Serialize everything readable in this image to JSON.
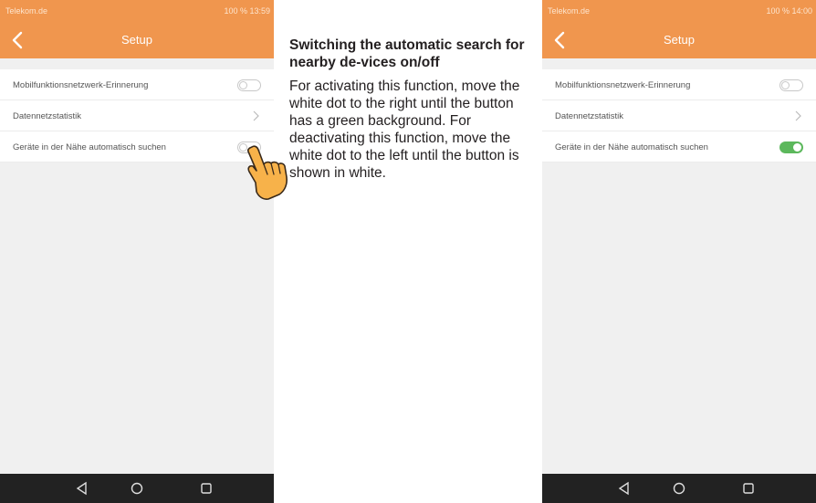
{
  "screens": [
    {
      "statusbar": {
        "carrier": "Telekom.de",
        "right": "100 %  13:59"
      },
      "title": "Setup",
      "rows": [
        {
          "label": "Mobilfunktionsnetzwerk-Erinnerung",
          "control": "toggle",
          "on": false
        },
        {
          "label": "Datennetzstatistik",
          "control": "chevron"
        },
        {
          "label": "Geräte in der Nähe automatisch suchen",
          "control": "toggle",
          "on": false
        }
      ]
    },
    {
      "statusbar": {
        "carrier": "Telekom.de",
        "right": "100 %  14:00"
      },
      "title": "Setup",
      "rows": [
        {
          "label": "Mobilfunktionsnetzwerk-Erinnerung",
          "control": "toggle",
          "on": false
        },
        {
          "label": "Datennetzstatistik",
          "control": "chevron"
        },
        {
          "label": "Geräte in der Nähe automatisch suchen",
          "control": "toggle",
          "on": true
        }
      ]
    }
  ],
  "description": {
    "heading": "Switching the automatic search for nearby de-vices on/off",
    "body": "For activating this function, move the white dot to the right until the button has a green background. For deactivating this function, move the white dot to the left until the button is shown in white."
  },
  "icons": {
    "back": "chevron-left-icon",
    "row_chevron": "chevron-right-icon",
    "nav_back": "triangle-back-icon",
    "nav_home": "circle-home-icon",
    "nav_recent": "square-recent-icon",
    "pointer": "pointing-hand-icon"
  },
  "colors": {
    "header": "#f0964e",
    "toggle_on": "#5cb85c",
    "navbar": "#222222",
    "background": "#f0f0f0"
  }
}
